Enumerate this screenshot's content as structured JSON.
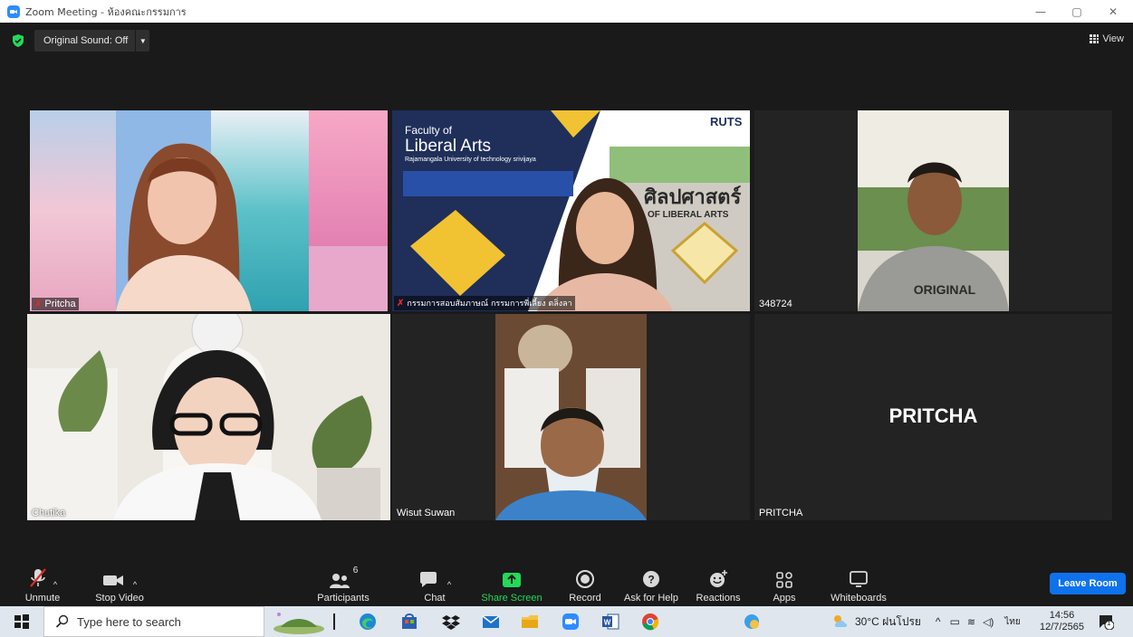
{
  "window": {
    "title": "Zoom Meeting - ห้องคณะกรรมการ",
    "controls": [
      "—",
      "▢",
      "✕"
    ]
  },
  "topbar": {
    "sound_label": "Original Sound: Off",
    "view_label": "View"
  },
  "participants_tiles": [
    {
      "name": "Pritcha",
      "muted": true
    },
    {
      "name": "กรรมการสอบสัมภาษณ์ กรรมการพี่เลี้ยง ตลิ่งลา",
      "muted": true
    },
    {
      "name": "348724",
      "muted": false
    },
    {
      "name": "Chutika",
      "muted": false,
      "active_speaker": true
    },
    {
      "name": "Wisut Suwan",
      "muted": false
    },
    {
      "name": "PRITCHA",
      "muted": false,
      "avatar_text": "PRITCHA"
    }
  ],
  "slide": {
    "line1": "Faculty of",
    "line2": "Liberal Arts",
    "line3": "Rajamangala University of technology srivijaya",
    "brand": "RUTS",
    "sign_thai": "ศิลปศาสตร์",
    "sign_en": "OF LIBERAL ARTS"
  },
  "shirt_text": "ORIGINAL",
  "toolbar": {
    "unmute": "Unmute",
    "stop_video": "Stop Video",
    "participants": "Participants",
    "participants_count": "6",
    "chat": "Chat",
    "share_screen": "Share Screen",
    "record": "Record",
    "ask_for_help": "Ask for Help",
    "reactions": "Reactions",
    "apps": "Apps",
    "whiteboards": "Whiteboards",
    "leave": "Leave Room"
  },
  "taskbar": {
    "search_placeholder": "Type here to search",
    "weather": "30°C ฝนโปรย",
    "lang": "ไทย",
    "time": "14:56",
    "date": "12/7/2565",
    "notification_count": "1"
  },
  "colors": {
    "accent": "#0e72ed",
    "active_outline": "#b4e04a",
    "share_green": "#23d959",
    "mute_red": "#e02828"
  }
}
